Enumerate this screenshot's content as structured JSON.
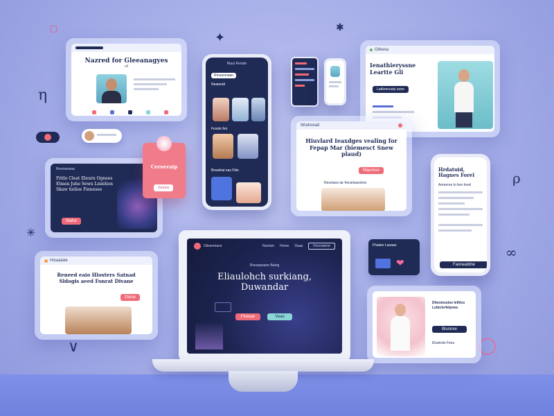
{
  "top_left_card": {
    "headline": "Nazred for Gleeanagyes",
    "subline": "all"
  },
  "top_right_card": {
    "logo": "Gilkesa",
    "headline": "Ienathieryssne Leartte Gli",
    "cta": "Ladkrenuaty aone"
  },
  "mid_card": {
    "logo": "Wodsread",
    "headline": "Hiuvlard Ieaxdges vealing for Fepap Mar (biemesct Snew plaud)",
    "cta": "Nlaumoo",
    "caption": "Rexelane lar frecielsaeslres"
  },
  "left_dark_card": {
    "logo": "Boomanwac",
    "headline": "Fittle Cleat Eleurn Ognees Elmen Juhe Sewn Lmlelion Skaw tielioe Fienesee",
    "cta": "Niahe"
  },
  "pink_card": {
    "title": "Ceroeraip",
    "cta": "Geame"
  },
  "right_phone": {
    "headline": "Hrdatuid, Hagnes Forel",
    "section": "Anmenre to bes fexel",
    "cta": "Faoneatdne"
  },
  "bottom_left_card": {
    "logo": "Hioaatate",
    "headline": "Reneed eaio Hlosters Satnad Sldogis aeed Fonrat Divane",
    "cta": "Ooiue"
  },
  "bottom_right_card": {
    "headline": "Dheomsstoe Ielhlos Lobiclerfelpnea",
    "cta": "Bluniree",
    "sub": "Ekarinds Feeu"
  },
  "laptop": {
    "logo": "Gilsenetane",
    "nav": [
      "Navlam",
      "Home",
      "Daaa"
    ],
    "button": "Finonalsrte",
    "eyebrow": "Rneaspeane Baing",
    "headline_line1": "Eliaulohch surkiang,",
    "headline_line2": "Duwandar",
    "cta_primary": "Fireeae",
    "cta_secondary": "Veae"
  },
  "center_phone": {
    "header": "Nlaui Reriale",
    "tag": "Rinuasmaan",
    "section1": "Neaiaralt",
    "section2": "Fesole fen",
    "section3": "Bnaahiai eas Fble"
  },
  "small_chip": {
    "label": "Fhaiiee Laoaae"
  },
  "colors": {
    "navy": "#1f2a55",
    "pink": "#f06b7a",
    "teal": "#8ad6d7",
    "background": "#a9b1ea"
  }
}
